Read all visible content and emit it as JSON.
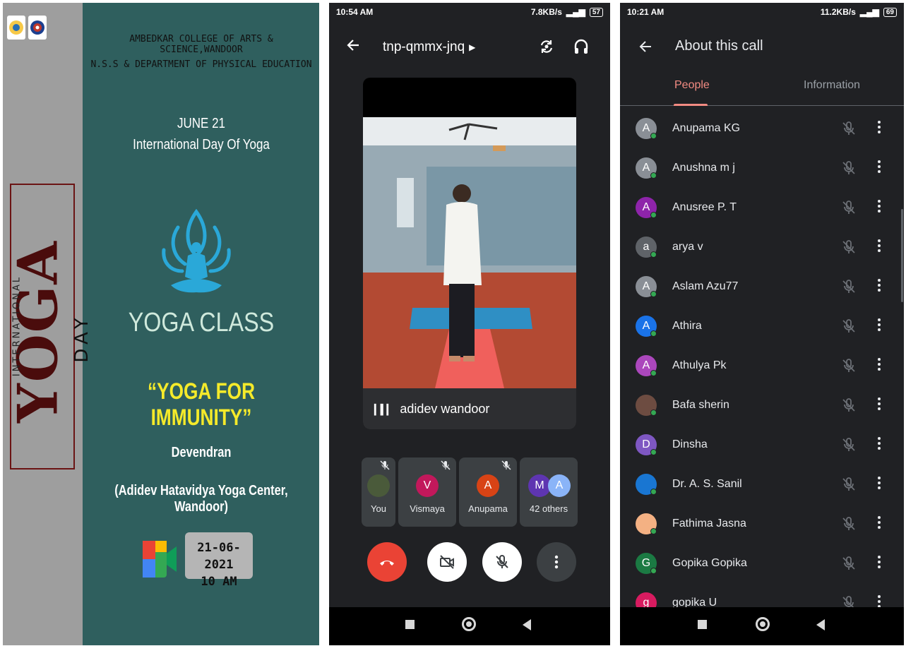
{
  "poster": {
    "college_line1": "AMBEDKAR COLLEGE OF ARTS & SCIENCE,WANDOOR",
    "college_line2": "N.S.S  &  DEPARTMENT OF PHYSICAL EDUCATION",
    "date_heading": "JUNE 21",
    "event_name": "International Day Of Yoga",
    "side_title_top": "INTERNATIONAL",
    "side_title_main": "YOGA",
    "side_title_bottom": "DAY",
    "class_title": "YOGA CLASS",
    "theme": "“YOGA FOR IMMUNITY”",
    "instructor_name": "Devendran",
    "instructor_org": "(Adidev Hatavidya Yoga Center, Wandoor)",
    "session_date": "21-06-2021",
    "session_time": "10 AM",
    "colors": {
      "teal": "#2f5f5e",
      "grey": "#9e9e9e",
      "theme_yellow": "#f5ea2a",
      "maroon": "#4a0c0c"
    }
  },
  "call_screen": {
    "status_time": "10:54 AM",
    "status_right": "7.8KB/s",
    "battery": "57",
    "meeting_code": "tnp-qmmx-jnq",
    "speaker_name": "adidev wandoor",
    "tiles": [
      {
        "label": "You",
        "initial": ""
      },
      {
        "label": "Vismaya",
        "initial": "V",
        "color": "#c2185b"
      },
      {
        "label": "Anupama",
        "initial": "A",
        "color": "#d84315"
      },
      {
        "label": "42 others",
        "initials": [
          "M",
          "A"
        ],
        "colors": [
          "#5e35b1",
          "#8ab4f8"
        ]
      }
    ],
    "colors": {
      "background": "#202124",
      "end_call": "#ea4335"
    }
  },
  "about_screen": {
    "status_time": "10:21 AM",
    "status_right": "11.2KB/s",
    "battery": "69",
    "title": "About this call",
    "tabs": [
      "People",
      "Information"
    ],
    "active_tab": "People",
    "people": [
      {
        "name": "Anupama KG",
        "initial": "A",
        "color": "#8a8f96"
      },
      {
        "name": "Anushna m j",
        "initial": "A",
        "color": "#8a8f96"
      },
      {
        "name": "Anusree P. T",
        "initial": "A",
        "color": "#8e24aa"
      },
      {
        "name": "arya v",
        "initial": "a",
        "color": "#5f6368"
      },
      {
        "name": "Aslam Azu77",
        "initial": "A",
        "color": "#8a8f96"
      },
      {
        "name": "Athira",
        "initial": "A",
        "color": "#1a73e8"
      },
      {
        "name": "Athulya Pk",
        "initial": "A",
        "color": "#ab47bc"
      },
      {
        "name": "Bafa sherin",
        "initial": "",
        "color": "#6d4c41",
        "photo": true
      },
      {
        "name": "Dinsha",
        "initial": "D",
        "color": "#7e57c2"
      },
      {
        "name": "Dr. A. S. Sanil",
        "initial": "",
        "color": "#1976d2",
        "photo": true
      },
      {
        "name": "Fathima Jasna",
        "initial": "",
        "color": "#f4b183",
        "photo": true
      },
      {
        "name": "Gopika Gopika",
        "initial": "G",
        "color": "#1b7a43"
      },
      {
        "name": "gopika U",
        "initial": "g",
        "color": "#d81b60"
      }
    ],
    "colors": {
      "accent": "#f28b82",
      "online": "#34a853"
    }
  }
}
